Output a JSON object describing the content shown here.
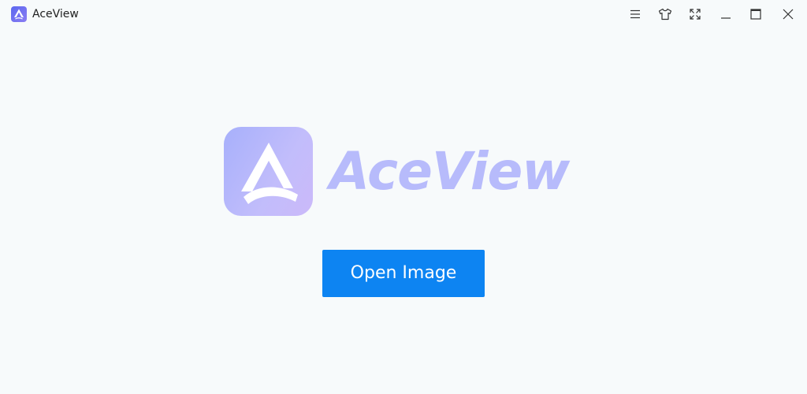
{
  "window": {
    "title": "AceView",
    "controls": [
      {
        "name": "menu-icon"
      },
      {
        "name": "shirt-icon"
      },
      {
        "name": "fullscreen-icon"
      },
      {
        "name": "minimize-icon"
      },
      {
        "name": "maximize-icon"
      },
      {
        "name": "close-icon"
      }
    ]
  },
  "main": {
    "logo_text": "AceView",
    "open_button_label": "Open Image"
  },
  "colors": {
    "background": "#f7fafb",
    "accent": "#0d84f2",
    "logo": "#b7bbfb"
  }
}
